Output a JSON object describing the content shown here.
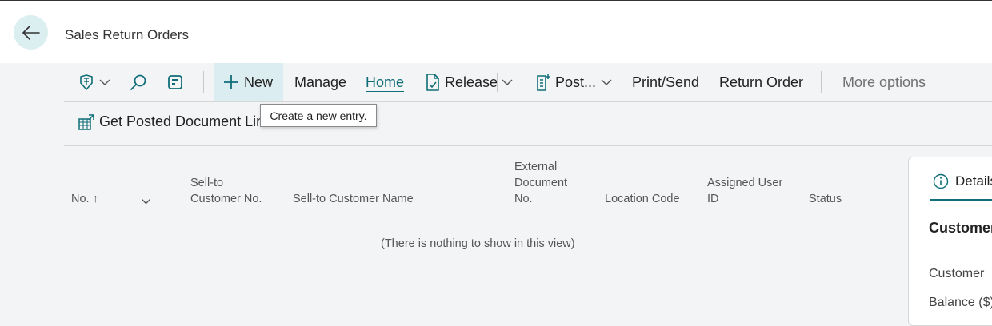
{
  "header": {
    "title": "Sales Return Orders",
    "back_icon": "arrow-left-icon"
  },
  "action_bar": {
    "new_label": "New",
    "manage_label": "Manage",
    "home_label": "Home",
    "release_label": "Release",
    "post_label": "Post...",
    "print_send_label": "Print/Send",
    "return_order_label": "Return Order",
    "more_options_label": "More options"
  },
  "sub_bar": {
    "get_posted_label": "Get Posted Document Lines"
  },
  "tooltip": {
    "text": "Create a new entry."
  },
  "table": {
    "columns": {
      "no": "No.",
      "sort_arrow": "↑",
      "sell_to_customer_no_1": "Sell-to",
      "sell_to_customer_no_2": "Customer No.",
      "sell_to_customer_name": "Sell-to Customer Name",
      "external_document_no_1": "External",
      "external_document_no_2": "Document",
      "external_document_no_3": "No.",
      "location_code": "Location Code",
      "assigned_user_id_1": "Assigned User",
      "assigned_user_id_2": "ID",
      "status": "Status"
    },
    "empty_message": "(There is nothing to show in this view)"
  },
  "factbox": {
    "tab_label": "Details",
    "heading": "Customer",
    "rows": [
      "Customer",
      "Balance ($)"
    ]
  },
  "colors": {
    "accent": "#0f6e77",
    "new_button_bg": "#dbedf0",
    "back_button_bg": "#dbeef0",
    "page_bg": "#f3f4f6"
  }
}
